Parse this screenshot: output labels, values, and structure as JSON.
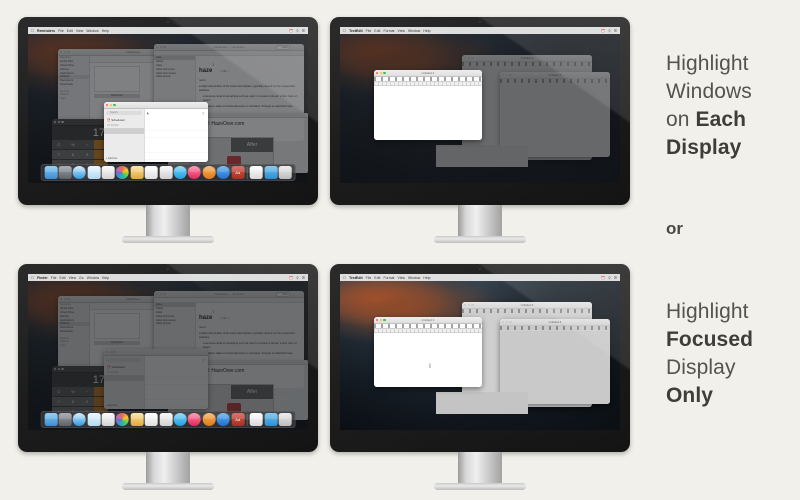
{
  "background_color": "#f2f0ea",
  "marketing": {
    "block_top": {
      "lines": [
        {
          "text": "Highlight",
          "bold": false
        },
        {
          "text": "Windows",
          "bold": false
        },
        {
          "text": "on ",
          "bold": false,
          "bold_tail": "Each"
        },
        {
          "text": "Display",
          "bold": true
        }
      ],
      "plain_1": "Highlight",
      "plain_2": "Windows",
      "plain_3a": "on ",
      "bold_3b": "Each",
      "bold_4": "Display"
    },
    "or_label": "or",
    "block_bottom": {
      "plain_1": "Highlight",
      "bold_2": "Focused",
      "plain_3": "Display",
      "bold_4": "Only"
    }
  },
  "monitors": [
    {
      "id": "top-left",
      "position": "top-left",
      "app": "Reminders",
      "dimmed": true,
      "focused_window": "Reminders",
      "menubar": {
        "apple": "\u001b",
        "app_name": "Reminders",
        "items": [
          "File",
          "Edit",
          "View",
          "Window",
          "Help"
        ],
        "right_items": [
          "↺",
          "🔍",
          "☰"
        ]
      },
      "windows": [
        {
          "name": "finder-window",
          "title": "HazeOver",
          "sidebar": [
            "Favorites",
            "All My Files",
            "iCloud Drive",
            "AirDrop",
            "Applications",
            "Desktop",
            "Documents",
            "Downloads",
            "Devices",
            "Shared",
            "Tags"
          ],
          "file": "HazeOver"
        },
        {
          "name": "dictionary-window",
          "title": "Dictionary — 11 found",
          "search_value": "haze",
          "results": [
            "haze",
            "hazed",
            "hazel",
            "hazel dormouse",
            "hazel dormouses",
            "hazel grouse"
          ],
          "headword": "haze",
          "superscript": "1",
          "pronunciation": "| hāz |",
          "pos": "noun",
          "def1": "a slight obscuration of the lower atmosphere, typically caused by fine suspended particles.",
          "def2": "a tenuous cloud of something such as vapor or smoke in the air: a faint haze of steam.",
          "def3": "[in singular] a state of mental obscurity or confusion: through an alcoholic haze."
        },
        {
          "name": "safari-window",
          "title": "HazeOver — Highlight the Front Window",
          "headline_text": "mo Video & Trial: HazeOver.com",
          "link_text": "HazeOver.com",
          "badge": "After"
        },
        {
          "name": "calculator-window",
          "display": "17",
          "keys": [
            "C",
            "%",
            "÷",
            "7",
            "8",
            "9",
            "4",
            "5",
            "6",
            "1",
            "2",
            "3"
          ]
        },
        {
          "name": "reminders-window",
          "title": "Reminders",
          "search_placeholder": "Search",
          "list_scheduled": "Scheduled",
          "list_header": "On My Mac",
          "add_list": "Add List"
        }
      ],
      "dock_items": [
        "finder",
        "launchpad",
        "safari",
        "mail",
        "photos",
        "color-wheel",
        "notes",
        "pages",
        "numbers",
        "messages",
        "itunes",
        "ibooks",
        "app-store",
        "font-book",
        "folder",
        "preview",
        "trash"
      ]
    },
    {
      "id": "top-right",
      "position": "top-right",
      "app": "TextEdit",
      "dimmed": true,
      "focused_window": "Untitled 2",
      "menubar": {
        "app_name": "TextEdit",
        "items": [
          "File",
          "Edit",
          "Format",
          "View",
          "Window",
          "Help"
        ],
        "right_items": [
          "⏻",
          "🔍",
          "☰"
        ]
      },
      "windows": [
        {
          "name": "textedit-window-back",
          "title": "Untitled 3"
        },
        {
          "name": "textedit-window-right",
          "title": "Untitled 4"
        },
        {
          "name": "textedit-window-front",
          "title": "Untitled 2",
          "content": ""
        }
      ]
    },
    {
      "id": "bottom-left",
      "position": "bottom-left",
      "app": "Finder",
      "dimmed": true,
      "whole_display_dimmed": true,
      "menubar": {
        "app_name": "Finder",
        "items": [
          "File",
          "Edit",
          "View",
          "Go",
          "Window",
          "Help"
        ],
        "right_items": [
          "⏻",
          "🔍",
          "☰"
        ]
      },
      "windows": [
        {
          "name": "finder-window",
          "title": "HazeOver"
        },
        {
          "name": "dictionary-window",
          "title": "Dictionary — 11 found"
        },
        {
          "name": "safari-window",
          "headline_text": "mo Video & Trial: HazeOver.com",
          "badge": "After"
        },
        {
          "name": "calculator-window",
          "display": "17"
        },
        {
          "name": "reminders-window",
          "list_scheduled": "Scheduled",
          "add_list": "Add List"
        }
      ],
      "dock_items": [
        "finder",
        "launchpad",
        "safari",
        "mail",
        "photos",
        "color-wheel",
        "notes",
        "pages",
        "numbers",
        "messages",
        "itunes",
        "ibooks",
        "app-store",
        "font-book",
        "folder",
        "preview",
        "trash"
      ]
    },
    {
      "id": "bottom-right",
      "position": "bottom-right",
      "app": "TextEdit",
      "dimmed": false,
      "focused_window": "Untitled 2",
      "menubar": {
        "app_name": "TextEdit",
        "items": [
          "File",
          "Edit",
          "Format",
          "View",
          "Window",
          "Help"
        ],
        "right_items": [
          "⏻",
          "🔍",
          "☰"
        ]
      },
      "windows": [
        {
          "name": "textedit-window-back",
          "title": "Untitled 3"
        },
        {
          "name": "textedit-window-right",
          "title": "Untitled 4"
        },
        {
          "name": "textedit-window-front",
          "title": "Untitled 2",
          "cursor": "I"
        }
      ]
    }
  ],
  "colors": {
    "bezel": "#1d1d1d",
    "stand": "#d4d4d4",
    "haze_overlay": "rgba(22,24,28,0.55)",
    "text_primary": "#555350",
    "text_bold": "#3f3d3a",
    "traffic_red": "#ff5f57",
    "traffic_yellow": "#febc2e",
    "traffic_green": "#28c840"
  },
  "dock_colors": {
    "finder": "#4b9fe0",
    "launchpad": "#6e7479",
    "safari": "#2f9bdf",
    "mail": "#9fd2f5",
    "photos": "#efefef",
    "color-wheel": "#e74c3c",
    "notes": "#f3c768",
    "pages": "#f2f2f2",
    "numbers": "#e9e9e9",
    "messages": "#3fb6ef",
    "itunes": "#f0567c",
    "ibooks": "#f08a2c",
    "app-store": "#2f88e0",
    "font-book": "#c0392b",
    "folder": "#f0f0f0",
    "preview": "#4aa7e8",
    "trash": "#d8d8d8"
  }
}
